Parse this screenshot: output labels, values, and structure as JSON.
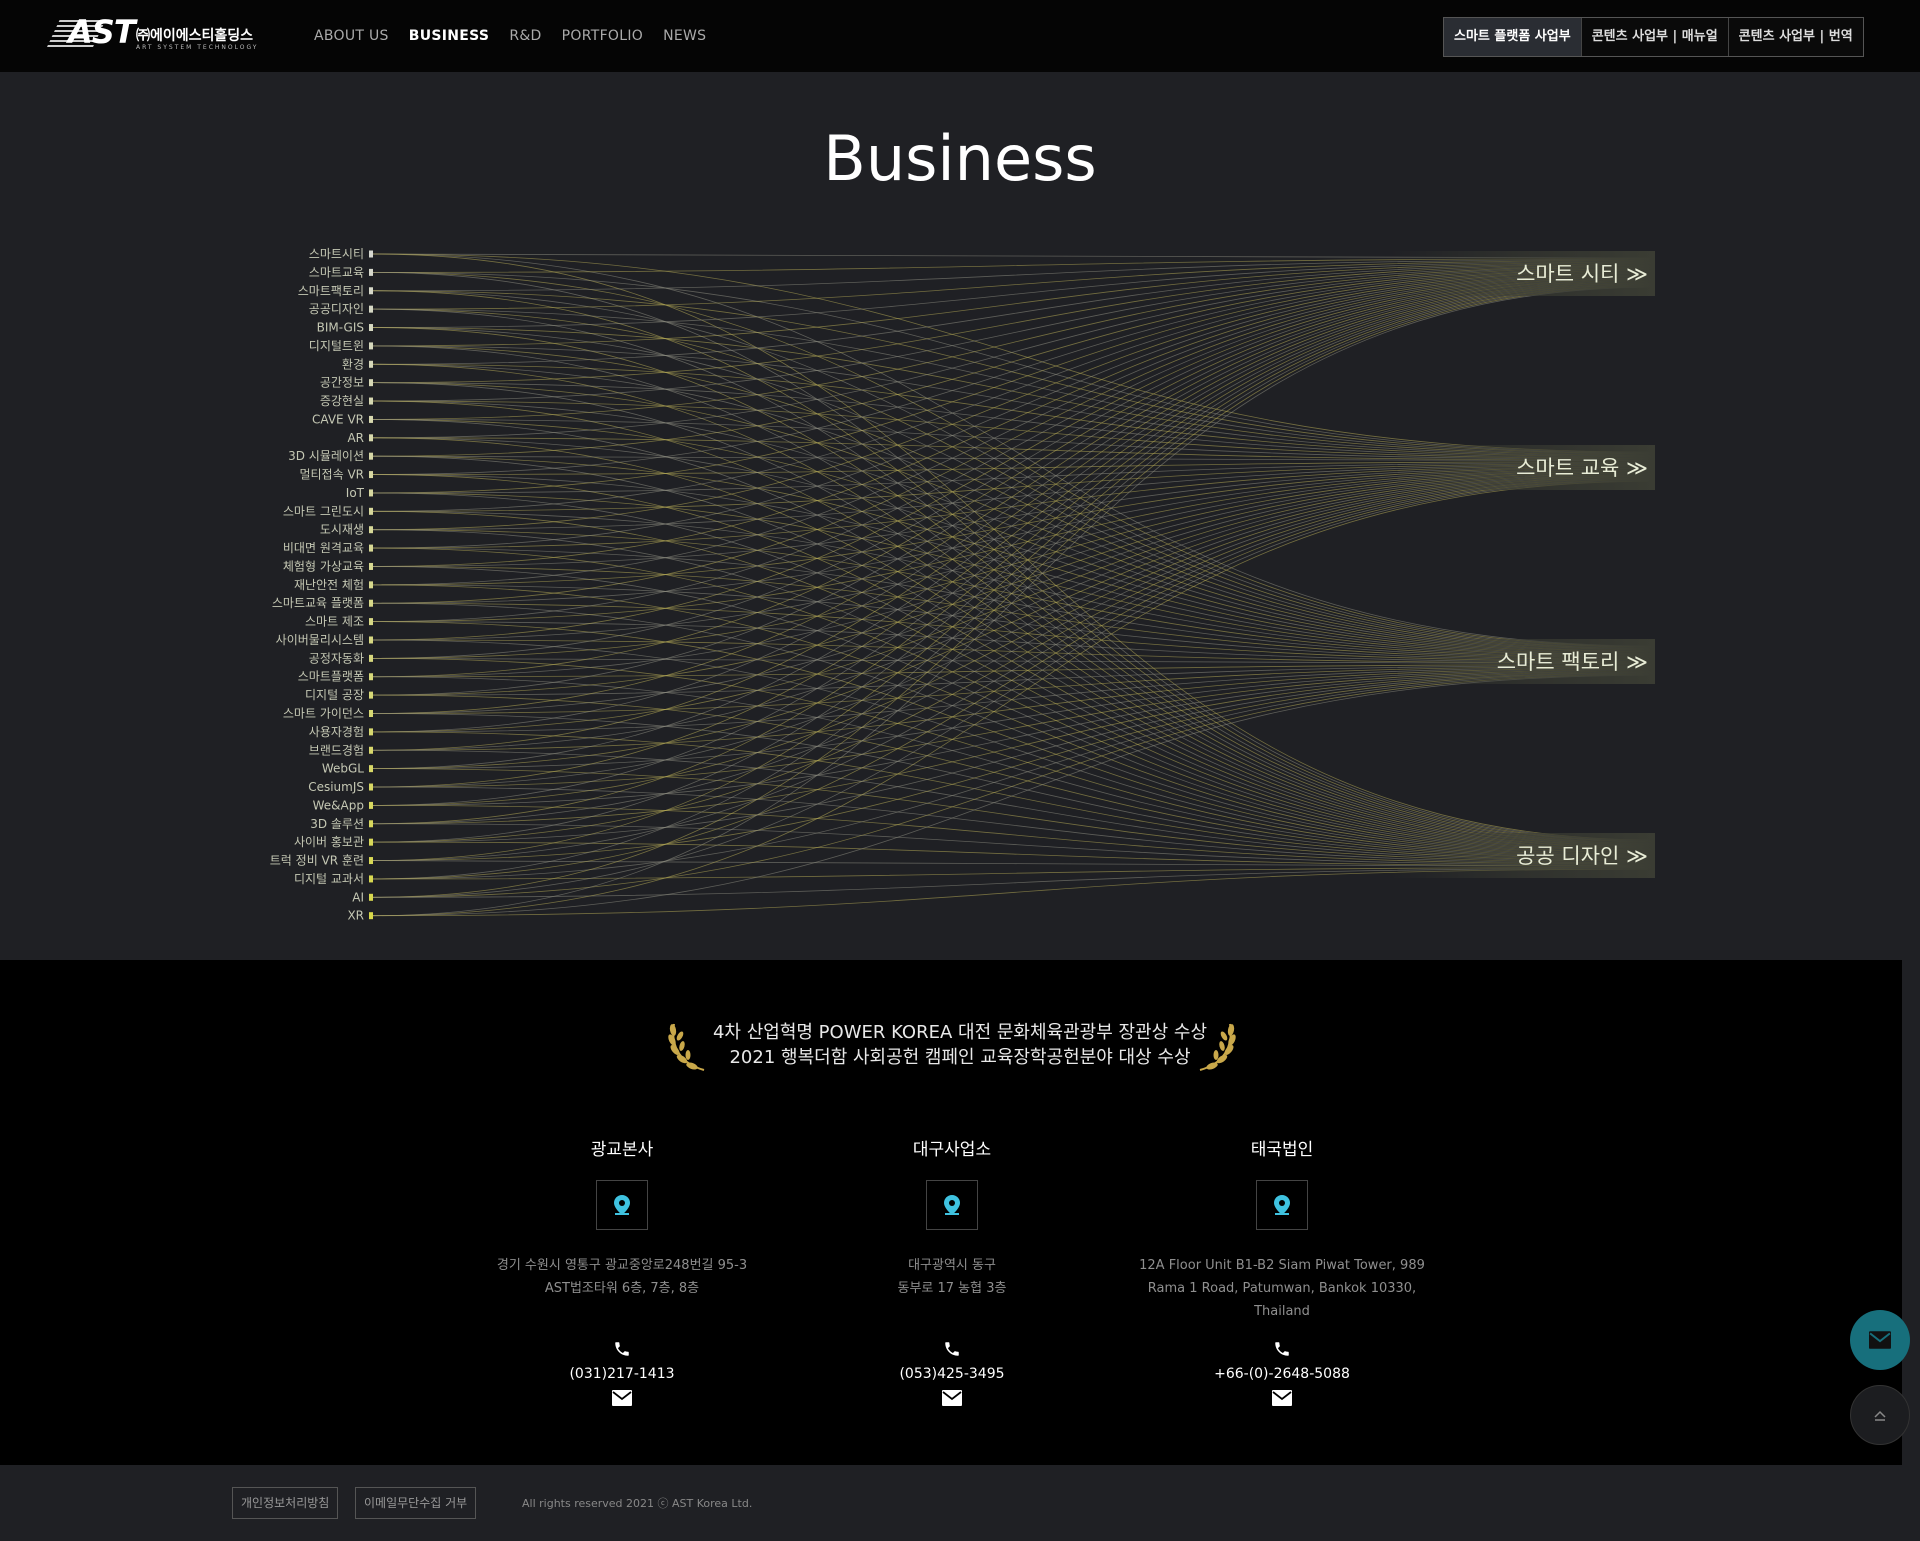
{
  "header": {
    "logo_mark": "AST",
    "logo_name": "㈜에이에스티홀딩스",
    "logo_sub": "ART SYSTEM TECHNOLOGY",
    "nav": [
      "ABOUT US",
      "BUSINESS",
      "R&D",
      "PORTFOLIO",
      "NEWS"
    ],
    "nav_active": "BUSINESS",
    "top_buttons": [
      "스마트 플랫폼 사업부",
      "콘텐츠 사업부 | 매뉴얼",
      "콘텐츠 사업부 | 번역"
    ]
  },
  "main": {
    "title": "Business",
    "keywords": [
      "스마트시티",
      "스마트교육",
      "스마트팩토리",
      "공공디자인",
      "BIM-GIS",
      "디지털트윈",
      "환경",
      "공간정보",
      "증강현실",
      "CAVE VR",
      "AR",
      "3D 시뮬레이션",
      "멀티접속 VR",
      "IoT",
      "스마트 그린도시",
      "도시재생",
      "비대면 원격교육",
      "체험형 가상교육",
      "재난안전 체험",
      "스마트교육 플랫폼",
      "스마트 제조",
      "사이버물리시스템",
      "공정자동화",
      "스마트플랫폼",
      "디지털 공장",
      "스마트 가이던스",
      "사용자경험",
      "브랜드경험",
      "WebGL",
      "CesiumJS",
      "We&App",
      "3D 솔루션",
      "사이버 홍보관",
      "트럭 정비 VR 훈련",
      "디지털 교과서",
      "AI",
      "XR"
    ],
    "categories": [
      "스마트 시티",
      "스마트 교육",
      "스마트 팩토리",
      "공공 디자인"
    ],
    "colors": {
      "line_a": "#8f8f84",
      "line_b": "#b8ad58",
      "keyword_top": "#d6d8d0",
      "keyword_bottom": "#d8d84a",
      "category_bg": "#3a3c33"
    }
  },
  "footer": {
    "awards": [
      "4차 산업혁명 POWER KOREA 대전 문화체육관광부 장관상 수상",
      "2021 행복더함 사회공헌 캠페인 교육장학공헌분야 대상 수상"
    ],
    "offices": [
      {
        "name": "광교본사",
        "address": [
          "경기 수원시 영통구 광교중앙로248번길 95-3",
          "AST법조타워 6층, 7층, 8층"
        ],
        "phone": "(031)217-1413"
      },
      {
        "name": "대구사업소",
        "address": [
          "대구광역시 동구",
          "동부로 17 농협 3층"
        ],
        "phone": "(053)425-3495"
      },
      {
        "name": "태국법인",
        "address": [
          "12A Floor Unit B1-B2 Siam Piwat Tower, 989",
          "Rama 1 Road, Patumwan, Bankok 10330,",
          "Thailand"
        ],
        "phone": "+66-(0)-2648-5088"
      }
    ],
    "policy_buttons": [
      "개인정보처리방침",
      "이메일무단수집 거부"
    ],
    "copyright": "All rights reserved 2021 ⓒ AST Korea Ltd."
  }
}
